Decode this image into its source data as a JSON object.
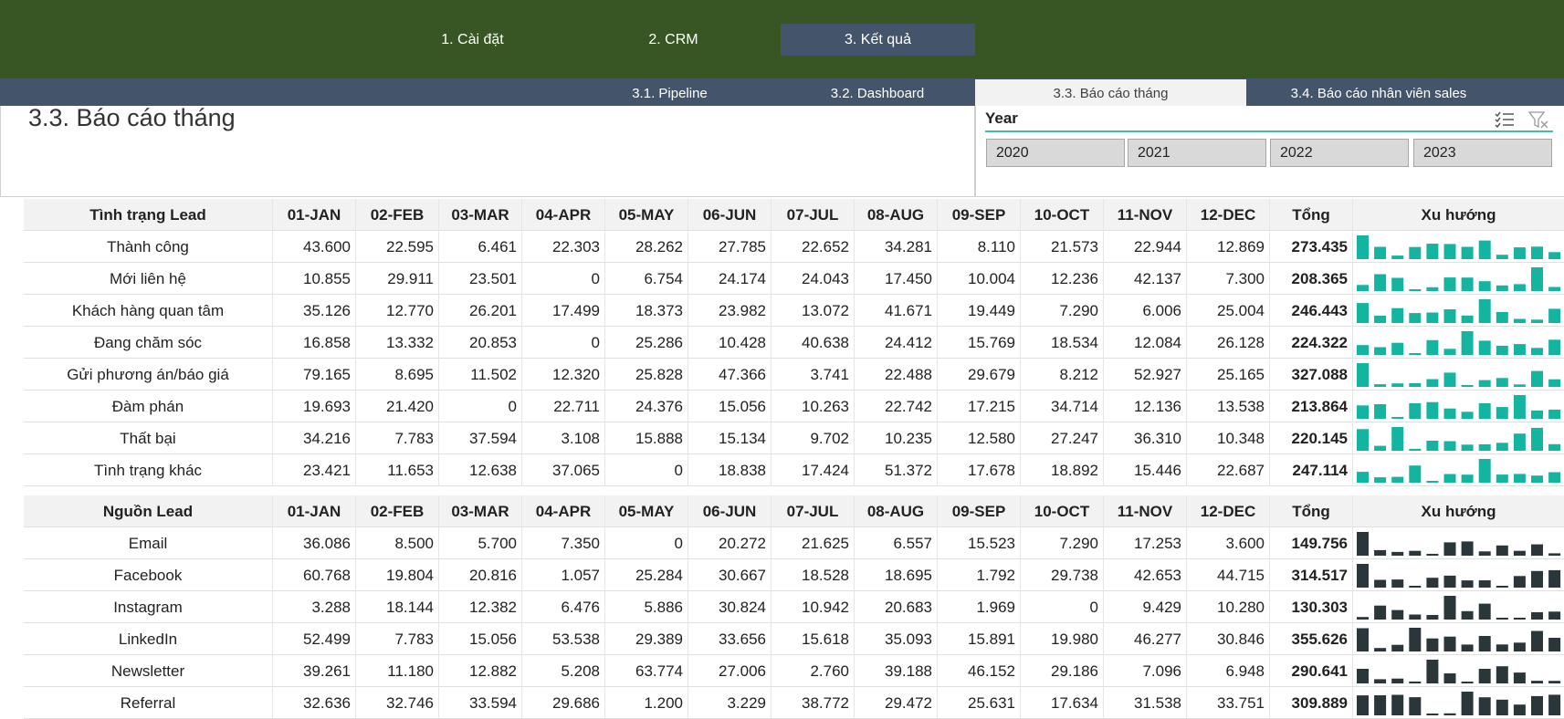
{
  "nav": {
    "main": [
      "1. Cài đặt",
      "2. CRM",
      "3. Kết quả"
    ],
    "sub": [
      "3.1. Pipeline",
      "3.2. Dashboard",
      "3.3. Báo cáo tháng",
      "3.4. Báo cáo nhân viên sales"
    ]
  },
  "page_title": "3.3. Báo cáo tháng",
  "slicer": {
    "title": "Year",
    "years": [
      "2020",
      "2021",
      "2022",
      "2023"
    ],
    "multi_select_icon": "multi-select-icon",
    "clear_filter_icon": "clear-filter-icon"
  },
  "colors": {
    "top_bar": "#375623",
    "sub_bar": "#44546a",
    "spark_status": "#13b5a0",
    "spark_source": "#2b363b"
  },
  "months": [
    "01-JAN",
    "02-FEB",
    "03-MAR",
    "04-APR",
    "05-MAY",
    "06-JUN",
    "07-JUL",
    "08-AUG",
    "09-SEP",
    "10-OCT",
    "11-NOV",
    "12-DEC"
  ],
  "total_label": "Tổng",
  "trend_label": "Xu hướng",
  "status_table": {
    "header": "Tình trạng Lead",
    "rows": [
      {
        "name": "Thành công",
        "values": [
          "43.600",
          "22.595",
          "6.461",
          "22.303",
          "28.262",
          "27.785",
          "22.652",
          "34.281",
          "8.110",
          "21.573",
          "22.944",
          "12.869"
        ],
        "total": "273.435"
      },
      {
        "name": "Mới liên hệ",
        "values": [
          "10.855",
          "29.911",
          "23.501",
          "0",
          "6.754",
          "24.174",
          "24.043",
          "17.450",
          "10.004",
          "12.236",
          "42.137",
          "7.300"
        ],
        "total": "208.365"
      },
      {
        "name": "Khách hàng quan tâm",
        "values": [
          "35.126",
          "12.770",
          "26.201",
          "17.499",
          "18.373",
          "23.982",
          "13.072",
          "41.671",
          "19.449",
          "7.290",
          "6.006",
          "25.004"
        ],
        "total": "246.443"
      },
      {
        "name": "Đang chăm sóc",
        "values": [
          "16.858",
          "13.332",
          "20.853",
          "0",
          "25.286",
          "10.428",
          "40.638",
          "24.412",
          "15.769",
          "18.534",
          "12.084",
          "26.128"
        ],
        "total": "224.322"
      },
      {
        "name": "Gửi phương án/báo giá",
        "values": [
          "79.165",
          "8.695",
          "11.502",
          "12.320",
          "25.828",
          "47.366",
          "3.741",
          "22.488",
          "29.679",
          "8.212",
          "52.927",
          "25.165"
        ],
        "total": "327.088"
      },
      {
        "name": "Đàm phán",
        "values": [
          "19.693",
          "21.420",
          "0",
          "22.711",
          "24.376",
          "15.056",
          "10.263",
          "22.742",
          "17.215",
          "34.714",
          "12.136",
          "13.538"
        ],
        "total": "213.864"
      },
      {
        "name": "Thất bại",
        "values": [
          "34.216",
          "7.783",
          "37.594",
          "3.108",
          "15.888",
          "15.134",
          "9.702",
          "10.235",
          "12.580",
          "27.247",
          "36.310",
          "10.348"
        ],
        "total": "220.145"
      },
      {
        "name": "Tình trạng khác",
        "values": [
          "23.421",
          "11.653",
          "12.638",
          "37.065",
          "0",
          "18.838",
          "17.424",
          "51.372",
          "17.678",
          "18.892",
          "15.446",
          "22.687"
        ],
        "total": "247.114"
      }
    ]
  },
  "source_table": {
    "header": "Nguồn Lead",
    "rows": [
      {
        "name": "Email",
        "values": [
          "36.086",
          "8.500",
          "5.700",
          "7.350",
          "0",
          "20.272",
          "21.625",
          "6.557",
          "15.523",
          "7.290",
          "17.253",
          "3.600"
        ],
        "total": "149.756"
      },
      {
        "name": "Facebook",
        "values": [
          "60.768",
          "19.804",
          "20.816",
          "1.057",
          "25.284",
          "30.667",
          "18.528",
          "18.695",
          "1.792",
          "29.738",
          "42.653",
          "44.715"
        ],
        "total": "314.517"
      },
      {
        "name": "Instagram",
        "values": [
          "3.288",
          "18.144",
          "12.382",
          "6.476",
          "5.886",
          "30.824",
          "10.942",
          "20.683",
          "1.969",
          "0",
          "9.429",
          "10.280"
        ],
        "total": "130.303"
      },
      {
        "name": "LinkedIn",
        "values": [
          "52.499",
          "7.783",
          "15.056",
          "53.538",
          "29.389",
          "33.656",
          "15.618",
          "35.093",
          "15.891",
          "19.980",
          "46.277",
          "30.846"
        ],
        "total": "355.626"
      },
      {
        "name": "Newsletter",
        "values": [
          "39.261",
          "11.180",
          "12.882",
          "5.208",
          "63.774",
          "27.006",
          "2.760",
          "39.188",
          "46.152",
          "29.186",
          "7.096",
          "6.948"
        ],
        "total": "290.641"
      },
      {
        "name": "Referral",
        "values": [
          "32.636",
          "32.746",
          "33.594",
          "29.686",
          "1.200",
          "3.229",
          "38.772",
          "29.472",
          "25.631",
          "17.634",
          "31.538",
          "33.751"
        ],
        "total": "309.889"
      }
    ]
  }
}
